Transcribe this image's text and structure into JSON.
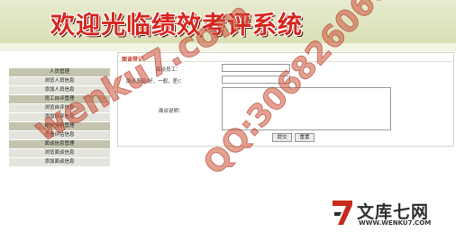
{
  "banner": {
    "title": "欢迎光临绩效考评系统"
  },
  "sidebar": {
    "items": [
      {
        "label": "人员管理",
        "kind": "head"
      },
      {
        "label": "浏览人员信息",
        "kind": "sub"
      },
      {
        "label": "添加人员信息",
        "kind": "sub"
      },
      {
        "label": "员工自评管理",
        "kind": "head"
      },
      {
        "label": "浏览自评信息",
        "kind": "sub"
      },
      {
        "label": "添加自评信息",
        "kind": "sub"
      },
      {
        "label": "统计分析管理",
        "kind": "head"
      },
      {
        "label": "查看评估信息",
        "kind": "sub"
      },
      {
        "label": "面谈信息管理",
        "kind": "head"
      },
      {
        "label": "浏览面谈信息",
        "kind": "sub"
      },
      {
        "label": "添加面谈信息",
        "kind": "sub"
      }
    ]
  },
  "form": {
    "title": "面谈登记",
    "employee_label": "面谈员工：",
    "employee_value": "",
    "time_label": "面谈表现(好，一般，差)：",
    "time_value": "",
    "notes_label": "面谈说明：",
    "notes_value": "",
    "submit_label": "提交",
    "reset_label": "重置"
  },
  "watermarks": {
    "site": "wenku7.com",
    "qq": "QQ:306826066"
  },
  "logo": {
    "name": "文库七网",
    "url": "WWW.WENKU7.COM"
  },
  "colors": {
    "banner_text": "#d5251d",
    "sidebar_head": "#c3c3ae",
    "sidebar_sub": "#e4e4dc",
    "watermark": "#cd5238"
  }
}
